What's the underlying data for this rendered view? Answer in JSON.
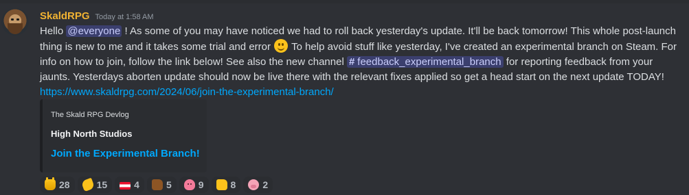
{
  "message": {
    "avatar_icon": "bearded-man-avatar",
    "username": "SkaldRPG",
    "username_color": "#f0b232",
    "timestamp": "Today at 1:58 AM",
    "text_1": "Hello ",
    "mention": "@everyone",
    "text_2": " ! As some of you may have noticed we had to roll back yesterday's update. It'll be back tomorrow! This whole post-launch thing is new to me and it takes some trial and error ",
    "emoji_icon": "slightly-smiling-face-emoji",
    "text_3": " To help avoid stuff like yesterday, I've created an experimental branch on Steam. For info on how to join, follow the link below! See also the new channel ",
    "channel_hash": "#",
    "channel_name": "feedback_experimental_branch",
    "text_4": " for reporting feedback from your jaunts. Yesterdays aborten update should now be live there with the relevant fixes applied so get a head start on the next update TODAY! ",
    "link": "https://www.skaldrpg.com/2024/06/join-the-experimental-branch/",
    "link_color": "#00a8fc"
  },
  "embed": {
    "provider": "The Skald RPG Devlog",
    "author": "High North Studios",
    "title": "Join the Experimental Branch!"
  },
  "reactions": [
    {
      "icon": "sign-of-the-horns-emoji",
      "count": "28"
    },
    {
      "icon": "flexed-biceps-emoji",
      "count": "15"
    },
    {
      "icon": "austria-flag-emoji",
      "count": "4"
    },
    {
      "icon": "thumbs-up-brown-emoji",
      "count": "5"
    },
    {
      "icon": "pink-blob-emoji",
      "count": "9"
    },
    {
      "icon": "thumbs-up-emoji",
      "count": "8"
    },
    {
      "icon": "pig-face-emoji",
      "count": "2"
    }
  ]
}
